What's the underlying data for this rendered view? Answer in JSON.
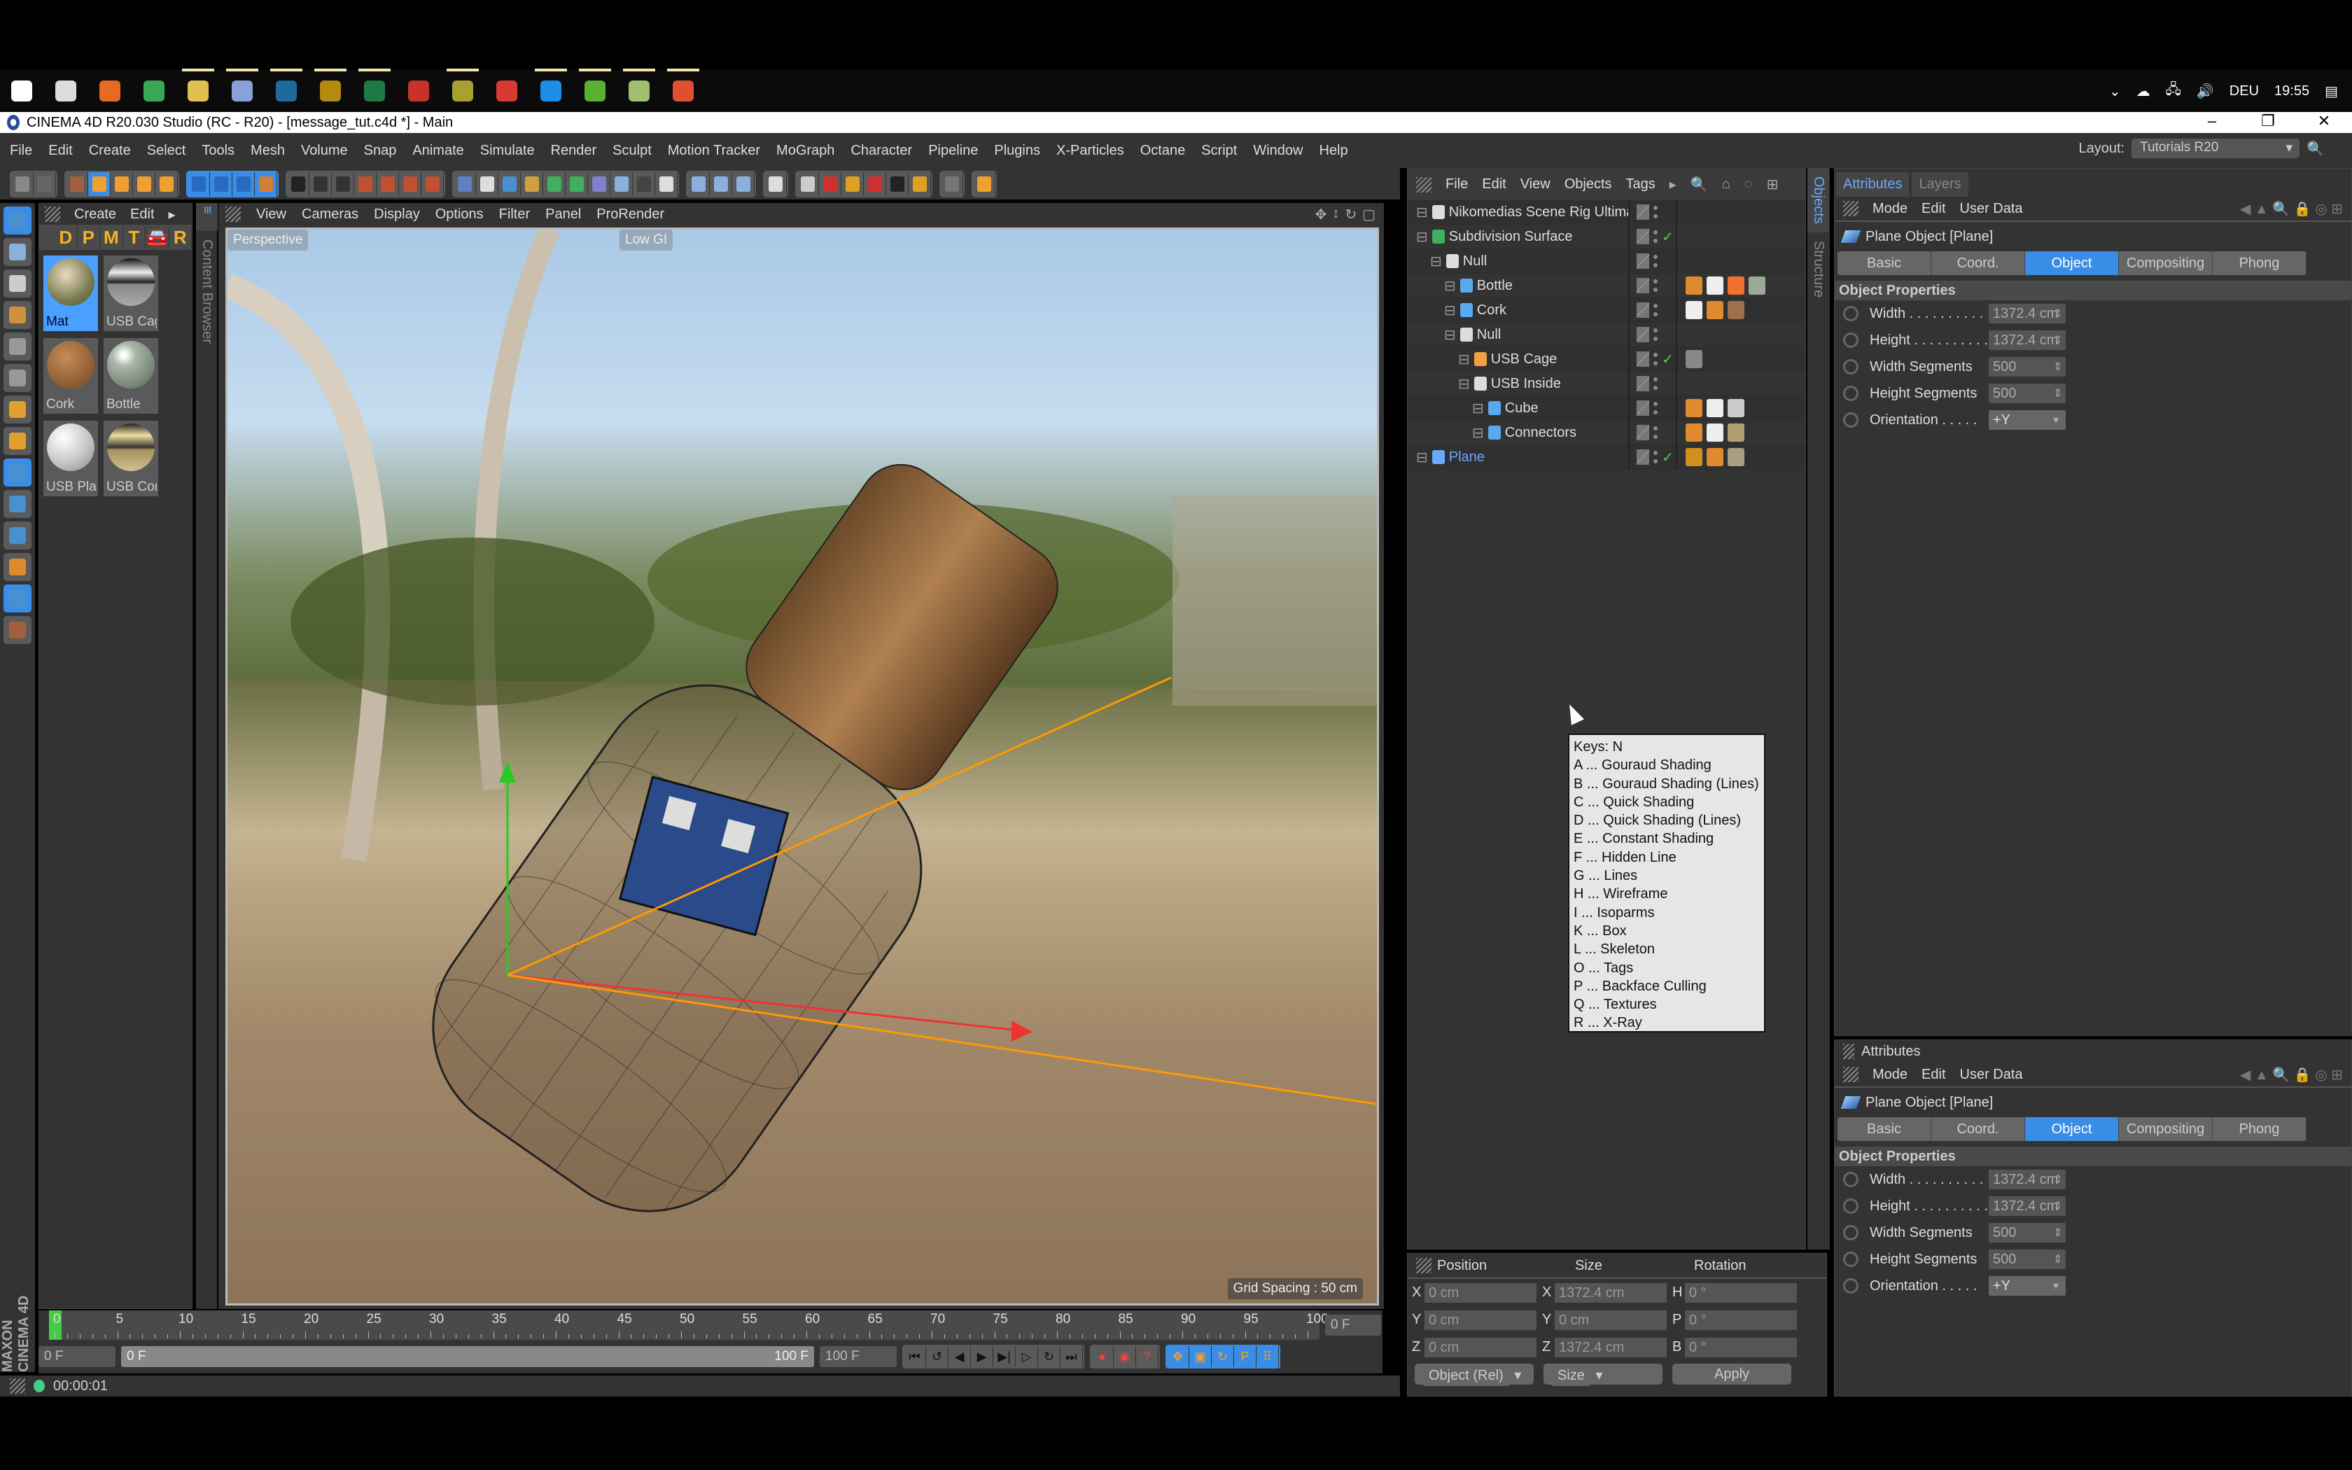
{
  "taskbar": {
    "apps": [
      {
        "icon": "windows-start-icon",
        "color": "#ffffff",
        "running": false
      },
      {
        "icon": "cortana-search-icon",
        "color": "#dddddd",
        "running": false
      },
      {
        "icon": "firefox-icon",
        "color": "#e66a1f",
        "running": false
      },
      {
        "icon": "chrome-icon",
        "color": "#3aa757",
        "running": false
      },
      {
        "icon": "app-s-icon",
        "color": "#e0c050",
        "running": true
      },
      {
        "icon": "cinema4d-icon",
        "color": "#8aa0d8",
        "running": true
      },
      {
        "icon": "photoshop-icon",
        "color": "#1c6b9c",
        "running": true
      },
      {
        "icon": "premiere-icon",
        "color": "#b48a10",
        "running": true
      },
      {
        "icon": "excel-icon",
        "color": "#1d7a45",
        "running": true
      },
      {
        "icon": "acrobat-icon",
        "color": "#c8322b",
        "running": false
      },
      {
        "icon": "app-q-icon",
        "color": "#a8a030",
        "running": true
      },
      {
        "icon": "vivaldi-icon",
        "color": "#d63a32",
        "running": false
      },
      {
        "icon": "skype-icon",
        "color": "#1b8ee8",
        "running": true
      },
      {
        "icon": "camtasia-icon",
        "color": "#5ab030",
        "running": true
      },
      {
        "icon": "app-map-icon",
        "color": "#a0c070",
        "running": true
      },
      {
        "icon": "app-c-icon",
        "color": "#e05030",
        "running": true
      }
    ],
    "tray": {
      "language": "DEU",
      "time": "19:55"
    }
  },
  "window": {
    "title": "CINEMA 4D R20.030 Studio (RC - R20) - [message_tut.c4d *] - Main",
    "controls": [
      "–",
      "❐",
      "✕"
    ]
  },
  "menubar": {
    "items": [
      "File",
      "Edit",
      "Create",
      "Select",
      "Tools",
      "Mesh",
      "Volume",
      "Snap",
      "Animate",
      "Simulate",
      "Render",
      "Sculpt",
      "Motion Tracker",
      "MoGraph",
      "Character",
      "Pipeline",
      "Plugins",
      "X-Particles",
      "Octane",
      "Script",
      "Window",
      "Help"
    ],
    "layout_label": "Layout:",
    "layout_value": "Tutorials R20"
  },
  "toolbar": {
    "groups": [
      {
        "active": false,
        "icons": [
          {
            "n": "undo-icon",
            "c": "#888"
          },
          {
            "n": "redo-icon",
            "c": "#666"
          }
        ]
      },
      {
        "active": false,
        "icons": [
          {
            "n": "live-selection-icon",
            "c": "#a06040"
          },
          {
            "n": "move-icon",
            "c": "#f0a030",
            "a": true
          },
          {
            "n": "scale-icon",
            "c": "#f0a030"
          },
          {
            "n": "rotate-icon",
            "c": "#f0a030"
          },
          {
            "n": "recent-tool-icon",
            "c": "#f0a030"
          }
        ]
      },
      {
        "active": true,
        "icons": [
          {
            "n": "x-axis-icon",
            "c": "#2a6ac0"
          },
          {
            "n": "y-axis-icon",
            "c": "#2a6ac0"
          },
          {
            "n": "z-axis-icon",
            "c": "#2a6ac0"
          },
          {
            "n": "coordinate-system-icon",
            "c": "#d08030"
          }
        ]
      },
      {
        "active": false,
        "icons": [
          {
            "n": "render-region-icon",
            "c": "#222"
          },
          {
            "n": "render-view-icon",
            "c": "#333"
          },
          {
            "n": "render-settings-icon",
            "c": "#333"
          },
          {
            "n": "render-to-picture-viewer-icon",
            "c": "#c05030"
          },
          {
            "n": "interactive-render-icon",
            "c": "#c05030"
          },
          {
            "n": "render-queue-icon",
            "c": "#c05030"
          },
          {
            "n": "edit-render-settings-icon",
            "c": "#c05030"
          }
        ]
      },
      {
        "active": false,
        "icons": [
          {
            "n": "nurbs-icon",
            "c": "#6080c0"
          },
          {
            "n": "null-icon",
            "c": "#ddd"
          },
          {
            "n": "cube-primitive-icon",
            "c": "#4a90d0"
          },
          {
            "n": "spline-pen-icon",
            "c": "#d0a040"
          },
          {
            "n": "subdivision-surface-icon",
            "c": "#40b060"
          },
          {
            "n": "cloner-icon",
            "c": "#40b060"
          },
          {
            "n": "deformer-icon",
            "c": "#8080d0"
          },
          {
            "n": "floor-icon",
            "c": "#8ab0e0"
          },
          {
            "n": "camera-icon",
            "c": "#444"
          },
          {
            "n": "light-icon",
            "c": "#ddd"
          }
        ]
      },
      {
        "active": false,
        "icons": [
          {
            "n": "points-mode-icon",
            "c": "#8ab0e0"
          },
          {
            "n": "edges-mode-icon",
            "c": "#8ab0e0"
          },
          {
            "n": "polygons-mode-icon",
            "c": "#8ab0e0"
          }
        ]
      },
      {
        "active": false,
        "icons": [
          {
            "n": "workplane-icon",
            "c": "#ddd"
          }
        ]
      },
      {
        "active": false,
        "icons": [
          {
            "n": "octane-live-viewer-icon",
            "c": "#ccc"
          },
          {
            "n": "octane-stop-icon",
            "c": "#d03030"
          },
          {
            "n": "octane-settings-icon",
            "c": "#e0a020"
          },
          {
            "n": "octane-disable-icon",
            "c": "#d03030"
          },
          {
            "n": "octane-pen-icon",
            "c": "#222"
          },
          {
            "n": "octane-download-icon",
            "c": "#e0a020"
          }
        ]
      },
      {
        "active": false,
        "icons": [
          {
            "n": "plugin-disabled-icon",
            "c": "#777"
          }
        ]
      },
      {
        "active": false,
        "icons": [
          {
            "n": "s-plugin-icon",
            "c": "#f0a030"
          }
        ]
      }
    ]
  },
  "left_palette": {
    "icons": [
      {
        "n": "make-editable-icon",
        "c": "#4a90d0",
        "a": true
      },
      {
        "n": "model-mode-icon",
        "c": "#8ab0e0"
      },
      {
        "n": "texture-mode-icon",
        "c": "#ccc"
      },
      {
        "n": "axis-mode-icon",
        "c": "#d09040"
      },
      {
        "n": "points-icon",
        "c": "#999"
      },
      {
        "n": "edges-icon",
        "c": "#999"
      },
      {
        "n": "polygons-icon",
        "c": "#e0a030"
      },
      {
        "n": "enable-axis-icon",
        "c": "#e0a030"
      },
      {
        "n": "tweak-icon",
        "c": "#4a90d0",
        "a": true
      },
      {
        "n": "snap-icon",
        "c": "#4a90d0"
      },
      {
        "n": "solo-icon",
        "c": "#4a90d0"
      },
      {
        "n": "sculpt-brush-icon",
        "c": "#e08a30"
      },
      {
        "n": "workplane-lock-icon",
        "c": "#4a90d0",
        "a": true
      },
      {
        "n": "lock-workplane-icon",
        "c": "#a06040"
      }
    ]
  },
  "material_manager": {
    "menu": [
      "Create",
      "Edit"
    ],
    "tool_letters": [
      "D",
      "P",
      "M",
      "T",
      "🚘",
      "R"
    ],
    "materials": [
      {
        "name": "Mat",
        "selected": true,
        "ball": "radial-gradient(circle at 40% 35%,#e8dcc0,#7a7a50 60%,#4a5a30)"
      },
      {
        "name": "USB Cage",
        "ball": "linear-gradient(180deg,#111 0%,#eee 30%,#222 50%,#888 55%,#aaa 100%)"
      },
      {
        "name": "Cork",
        "ball": "radial-gradient(circle at 40% 35%,#c88c58,#8a5a30 70%)"
      },
      {
        "name": "Bottle",
        "ball": "radial-gradient(circle at 35% 30%,#fff 5%,#a9b8a8 25%,#6a7a6a 80%)"
      },
      {
        "name": "USB Plastic",
        "ball": "radial-gradient(circle at 35% 30%,#fff,#ccc 50%,#888)"
      },
      {
        "name": "USB Connector",
        "ball": "linear-gradient(180deg,#222 0%,#f0e0a0 25%,#333 50%,#a89060 55%,#d0c090 100%)"
      }
    ]
  },
  "viewport": {
    "menu": [
      "View",
      "Cameras",
      "Display",
      "Options",
      "Filter",
      "Panel",
      "ProRender"
    ],
    "camera_label": "Perspective",
    "gi_label": "Low GI",
    "grid_spacing": "Grid Spacing : 50 cm",
    "side_tab": "Content Browser"
  },
  "timeline": {
    "ticks": [
      0,
      5,
      10,
      15,
      20,
      25,
      30,
      35,
      40,
      45,
      50,
      55,
      60,
      65,
      70,
      75,
      80,
      85,
      90,
      95,
      100
    ],
    "current_frame": "0 F",
    "start_frame": "0 F",
    "range_start": "0 F",
    "range_end": "100 F",
    "end_frame": "100 F",
    "transport": [
      "⏮",
      "↺",
      "◀",
      "▶",
      "▶|",
      "▷",
      "↻",
      "⏭"
    ],
    "record": [
      "●",
      "◉",
      "?"
    ],
    "keys": [
      "✥",
      "▣",
      "↻",
      "P",
      "⠿"
    ]
  },
  "status": {
    "time": "00:00:01",
    "brand": "MAXON CINEMA 4D"
  },
  "object_manager": {
    "menu": [
      "File",
      "Edit",
      "View",
      "Objects",
      "Tags"
    ],
    "objects": [
      {
        "name": "Nikomedias Scene Rig Ultimate",
        "depth": 0,
        "icon": "null-object-icon",
        "icolor": "#ddd",
        "check": false,
        "tags": []
      },
      {
        "name": "Subdivision Surface",
        "depth": 0,
        "icon": "subdivision-surface-icon",
        "icolor": "#40b060",
        "check": true,
        "tags": []
      },
      {
        "name": "Null",
        "depth": 1,
        "icon": "null-object-icon",
        "icolor": "#ddd",
        "check": false,
        "tags": []
      },
      {
        "name": "Bottle",
        "depth": 2,
        "icon": "polygon-object-icon",
        "icolor": "#5aa8f0",
        "check": false,
        "tags": [
          {
            "n": "phong-tag-icon",
            "c": "#e08a30"
          },
          {
            "n": "uvw-tag-icon",
            "c": "#eee"
          },
          {
            "n": "selection-tag-icon",
            "c": "#f07030"
          },
          {
            "n": "material-tag-bottle-icon",
            "c": "#99aa99"
          }
        ]
      },
      {
        "name": "Cork",
        "depth": 2,
        "icon": "polygon-object-icon",
        "icolor": "#5aa8f0",
        "check": false,
        "tags": [
          {
            "n": "uvw-tag-icon",
            "c": "#eee"
          },
          {
            "n": "phong-tag-icon",
            "c": "#e08a30"
          },
          {
            "n": "material-tag-cork-icon",
            "c": "#a0704a"
          }
        ]
      },
      {
        "name": "Null",
        "depth": 2,
        "icon": "null-object-icon",
        "icolor": "#ddd",
        "check": false,
        "tags": []
      },
      {
        "name": "USB Cage",
        "depth": 3,
        "icon": "cloth-object-icon",
        "icolor": "#f0a040",
        "check": true,
        "tags": [
          {
            "n": "material-tag-usb-cage-icon",
            "c": "#888"
          }
        ]
      },
      {
        "name": "USB Inside",
        "depth": 3,
        "icon": "null-object-icon",
        "icolor": "#ddd",
        "check": false,
        "tags": []
      },
      {
        "name": "Cube",
        "depth": 4,
        "icon": "polygon-object-icon",
        "icolor": "#5aa8f0",
        "check": false,
        "tags": [
          {
            "n": "phong-tag-icon",
            "c": "#e08a30"
          },
          {
            "n": "uvw-tag-icon",
            "c": "#eee"
          },
          {
            "n": "material-tag-plastic-icon",
            "c": "#ccc"
          }
        ]
      },
      {
        "name": "Connectors",
        "depth": 4,
        "icon": "polygon-object-icon",
        "icolor": "#5aa8f0",
        "check": false,
        "tags": [
          {
            "n": "phong-tag-icon",
            "c": "#e08a30"
          },
          {
            "n": "uvw-tag-icon",
            "c": "#eee"
          },
          {
            "n": "material-tag-connector-icon",
            "c": "#b0a070"
          }
        ]
      },
      {
        "name": "Plane",
        "depth": 0,
        "icon": "plane-object-icon",
        "icolor": "#6aa9ff",
        "check": true,
        "selected": true,
        "tags": [
          {
            "n": "display-tag-icon",
            "c": "#d09020"
          },
          {
            "n": "phong-tag-icon",
            "c": "#e08a30"
          },
          {
            "n": "material-tag-mat-icon",
            "c": "#a8a080"
          }
        ]
      }
    ],
    "side_tabs": [
      "Objects",
      "Structure"
    ]
  },
  "attributes": {
    "tabs": [
      "Attributes",
      "Layers"
    ],
    "panel2_title": "Attributes",
    "menu": [
      "Mode",
      "Edit",
      "User Data"
    ],
    "object_title": "Plane Object [Plane]",
    "prop_tabs": [
      "Basic",
      "Coord.",
      "Object",
      "Compositing",
      "Phong"
    ],
    "active_tab": "Object",
    "section": "Object Properties",
    "props": [
      {
        "label": "Width . . . . . . . . . .",
        "value": "1372.4 cm"
      },
      {
        "label": "Height . . . . . . . . . .",
        "value": "1372.4 cm"
      },
      {
        "label": "Width Segments",
        "value": "500"
      },
      {
        "label": "Height Segments",
        "value": "500"
      },
      {
        "label": "Orientation . . . . .",
        "value": "+Y",
        "dropdown": true
      }
    ]
  },
  "coordinates": {
    "headers": [
      "Position",
      "Size",
      "Rotation"
    ],
    "rows": [
      {
        "pa": "X",
        "p": "0 cm",
        "sa": "X",
        "s": "1372.4 cm",
        "ra": "H",
        "r": "0 °"
      },
      {
        "pa": "Y",
        "p": "0 cm",
        "sa": "Y",
        "s": "0 cm",
        "ra": "P",
        "r": "0 °"
      },
      {
        "pa": "Z",
        "p": "0 cm",
        "sa": "Z",
        "s": "1372.4 cm",
        "ra": "B",
        "r": "0 °"
      }
    ],
    "mode": "Object (Rel)",
    "size_mode": "Size",
    "apply": "Apply"
  },
  "tooltip": {
    "lines": [
      "Keys: N",
      "A ... Gouraud Shading",
      "B ... Gouraud Shading (Lines)",
      "C ... Quick Shading",
      "D ... Quick Shading (Lines)",
      "E ... Constant Shading",
      "F ... Hidden Line",
      "G ... Lines",
      "H ... Wireframe",
      "I ... Isoparms",
      "K ... Box",
      "L ... Skeleton",
      "O ... Tags",
      "P ... Backface Culling",
      "Q ... Textures",
      "R ... X-Ray"
    ]
  },
  "colors": {
    "accent": "#3a8de6",
    "panel": "#333333",
    "selected_text": "#6aa9ff"
  }
}
